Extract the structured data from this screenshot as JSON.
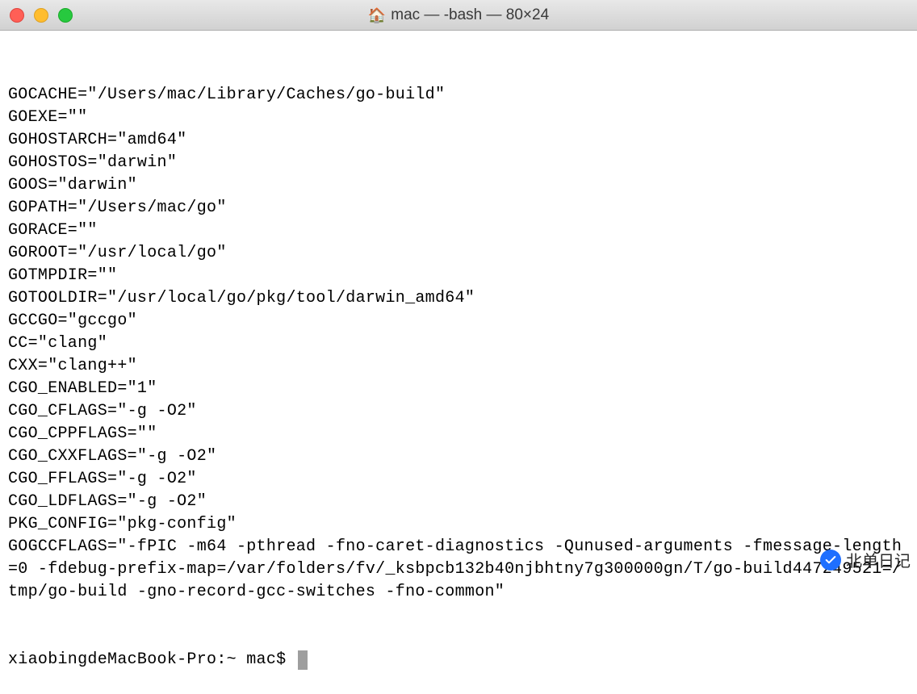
{
  "window": {
    "title": "mac — -bash — 80×24"
  },
  "terminal": {
    "lines": [
      "GOCACHE=\"/Users/mac/Library/Caches/go-build\"",
      "GOEXE=\"\"",
      "GOHOSTARCH=\"amd64\"",
      "GOHOSTOS=\"darwin\"",
      "GOOS=\"darwin\"",
      "GOPATH=\"/Users/mac/go\"",
      "GORACE=\"\"",
      "GOROOT=\"/usr/local/go\"",
      "GOTMPDIR=\"\"",
      "GOTOOLDIR=\"/usr/local/go/pkg/tool/darwin_amd64\"",
      "GCCGO=\"gccgo\"",
      "CC=\"clang\"",
      "CXX=\"clang++\"",
      "CGO_ENABLED=\"1\"",
      "CGO_CFLAGS=\"-g -O2\"",
      "CGO_CPPFLAGS=\"\"",
      "CGO_CXXFLAGS=\"-g -O2\"",
      "CGO_FFLAGS=\"-g -O2\"",
      "CGO_LDFLAGS=\"-g -O2\"",
      "PKG_CONFIG=\"pkg-config\"",
      "GOGCCFLAGS=\"-fPIC -m64 -pthread -fno-caret-diagnostics -Qunused-arguments -fmessage-length=0 -fdebug-prefix-map=/var/folders/fv/_ksbpcb132b40njbhtny7g300000gn/T/go-build447249521=/tmp/go-build -gno-record-gcc-switches -fno-common\""
    ],
    "prompt": "xiaobingdeMacBook-Pro:~ mac$ "
  },
  "watermark": {
    "text": "北单日记"
  }
}
